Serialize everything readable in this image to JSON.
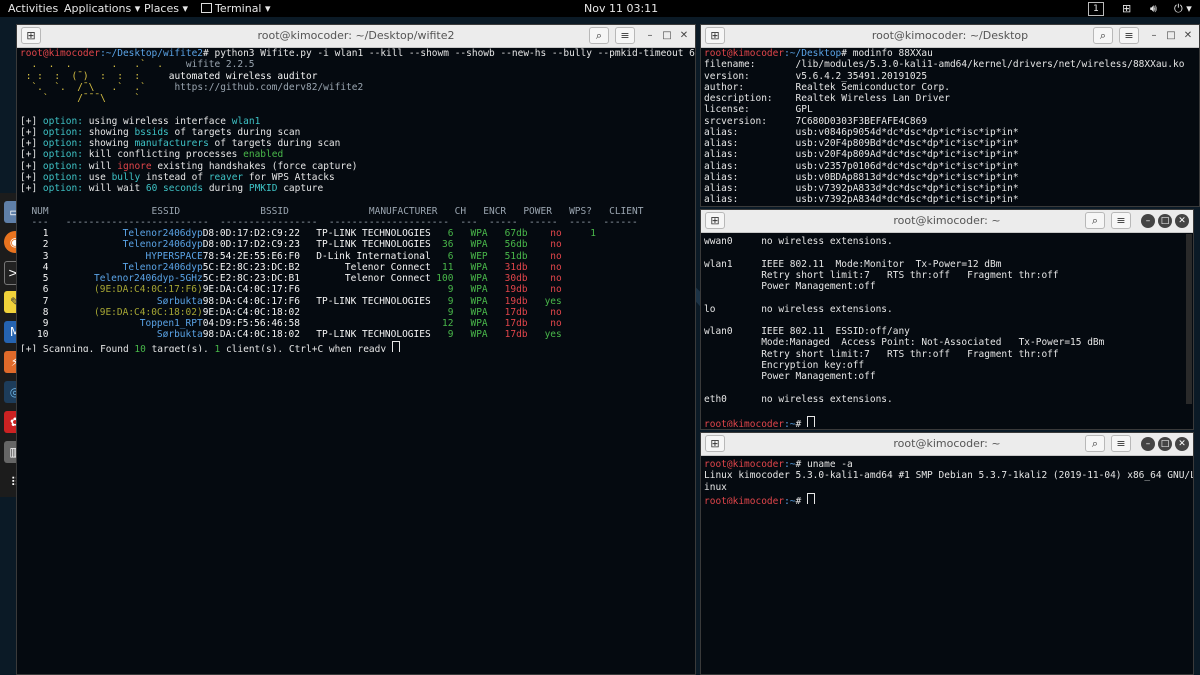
{
  "topbar": {
    "activities": "Activities",
    "applications": "Applications ▾",
    "places": "Places ▾",
    "terminal": "Terminal ▾",
    "clock": "Nov 11  03:11",
    "workspace": "1"
  },
  "dock": {
    "items": [
      "files-icon",
      "firefox-icon",
      "terminal-icon",
      "editor-icon",
      "metasploit-icon",
      "burp-icon",
      "eye-icon",
      "cherrytree-icon",
      "trash-icon",
      "apps-grid-icon"
    ]
  },
  "win1": {
    "title": "root@kimocoder: ~/Desktop/wifite2",
    "prompt_user": "root@kimocoder",
    "prompt_path": ":~/Desktop/wifite2",
    "command": "# python3 Wifite.py -i wlan1 --kill --showm --showb --new-hs --bully --pmkid-timeout 60",
    "logo1": "  .  .  .       .   .`  .",
    "logo2": " : :  :  (¯)  :  :  :",
    "logo3": "  `.  `.  /¯\\   .`  .`",
    "logo4": "    `     /¯¯¯\\     `",
    "app_name": "wifite 2.2.5",
    "app_desc": "automated wireless auditor",
    "app_url": "https://github.com/derv82/wifite2",
    "options": [
      {
        "pre": "using wireless interface ",
        "hl": "wlan1",
        "post": ""
      },
      {
        "pre": "showing ",
        "hl": "bssids",
        "post": " of targets during scan"
      },
      {
        "pre": "showing ",
        "hl": "manufacturers",
        "post": " of targets during scan"
      },
      {
        "pre": "kill conflicting processes ",
        "hl": "enabled",
        "post": ""
      },
      {
        "pre": "will ",
        "hl": "ignore",
        "post": " existing handshakes (force capture)"
      },
      {
        "pre": "use ",
        "hl": "bully",
        "post": " instead of "
      },
      {
        "pre": "will wait ",
        "hl": "60 seconds",
        "post": " during "
      }
    ],
    "opt_bracket": "[+]",
    "opt_label": "option:",
    "opt6_hl2": "reaver",
    "opt6_tail": " for WPS Attacks",
    "opt7_hl2": "PMKID",
    "opt7_tail": " capture",
    "table_header": "  NUM                  ESSID              BSSID              MANUFACTURER   CH   ENCR   POWER   WPS?   CLIENT",
    "table_rule": "  ---   -------------------------  -----------------  ---------------------  ---  -----  -----  ----  ------",
    "rows": [
      {
        "num": "1",
        "essid": "Telenor2406dyp",
        "bssid": "D8:0D:17:D2:C9:22",
        "manu": "TP-LINK TECHNOLOGIES",
        "ch": "6",
        "encr": "WPA",
        "power": "67db",
        "pc": "green",
        "wps": "no",
        "wc": "red",
        "client": "1"
      },
      {
        "num": "2",
        "essid": "Telenor2406dyp",
        "bssid": "D8:0D:17:D2:C9:23",
        "manu": "TP-LINK TECHNOLOGIES",
        "ch": "36",
        "encr": "WPA",
        "power": "56db",
        "pc": "green",
        "wps": "no",
        "wc": "red",
        "client": ""
      },
      {
        "num": "3",
        "essid": "HYPERSPACE",
        "bssid": "78:54:2E:55:E6:F0",
        "manu": "D-Link International",
        "ch": "6",
        "encr": "WEP",
        "power": "51db",
        "pc": "green",
        "wps": "no",
        "wc": "red",
        "client": ""
      },
      {
        "num": "4",
        "essid": "Telenor2406dyp",
        "bssid": "5C:E2:8C:23:DC:B2",
        "manu": "Telenor Connect",
        "ch": "11",
        "encr": "WPA",
        "power": "31db",
        "pc": "red",
        "wps": "no",
        "wc": "red",
        "client": ""
      },
      {
        "num": "5",
        "essid": "Telenor2406dyp-5GHz",
        "bssid": "5C:E2:8C:23:DC:B1",
        "manu": "Telenor Connect",
        "ch": "100",
        "encr": "WPA",
        "power": "30db",
        "pc": "red",
        "wps": "no",
        "wc": "red",
        "client": ""
      },
      {
        "num": "6",
        "essid": "(9E:DA:C4:0C:17:F6)",
        "bssid": "9E:DA:C4:0C:17:F6",
        "manu": "",
        "ch": "9",
        "encr": "WPA",
        "power": "19db",
        "pc": "red",
        "wps": "no",
        "wc": "red",
        "client": ""
      },
      {
        "num": "7",
        "essid": "Sørbukta",
        "bssid": "98:DA:C4:0C:17:F6",
        "manu": "TP-LINK TECHNOLOGIES",
        "ch": "9",
        "encr": "WPA",
        "power": "19db",
        "pc": "red",
        "wps": "yes",
        "wc": "green",
        "client": ""
      },
      {
        "num": "8",
        "essid": "(9E:DA:C4:0C:18:02)",
        "bssid": "9E:DA:C4:0C:18:02",
        "manu": "",
        "ch": "9",
        "encr": "WPA",
        "power": "17db",
        "pc": "red",
        "wps": "no",
        "wc": "red",
        "client": ""
      },
      {
        "num": "9",
        "essid": "Toppen1_RPT",
        "bssid": "04:D9:F5:56:46:58",
        "manu": "",
        "ch": "12",
        "encr": "WPA",
        "power": "17db",
        "pc": "red",
        "wps": "no",
        "wc": "red",
        "client": ""
      },
      {
        "num": "10",
        "essid": "Sørbukta",
        "bssid": "98:DA:C4:0C:18:02",
        "manu": "TP-LINK TECHNOLOGIES",
        "ch": "9",
        "encr": "WPA",
        "power": "17db",
        "pc": "red",
        "wps": "yes",
        "wc": "green",
        "client": ""
      }
    ],
    "scan_pre": "[+] Scanning. Found ",
    "scan_targets": "10",
    "scan_mid": " target(s), ",
    "scan_clients": "1",
    "scan_post": " client(s). Ctrl+C when ready "
  },
  "win2": {
    "title": "root@kimocoder: ~/Desktop",
    "prompt_user": "root@kimocoder",
    "prompt_path": ":~/Desktop",
    "command": "# modinfo 88XXau",
    "lines": [
      "filename:       /lib/modules/5.3.0-kali1-amd64/kernel/drivers/net/wireless/88XXau.ko",
      "version:        v5.6.4.2_35491.20191025",
      "author:         Realtek Semiconductor Corp.",
      "description:    Realtek Wireless Lan Driver",
      "license:        GPL",
      "srcversion:     7C680D0303F3BEFAFE4C869",
      "alias:          usb:v0846p9054d*dc*dsc*dp*ic*isc*ip*in*",
      "alias:          usb:v20F4p809Bd*dc*dsc*dp*ic*isc*ip*in*",
      "alias:          usb:v20F4p809Ad*dc*dsc*dp*ic*isc*ip*in*",
      "alias:          usb:v2357p0106d*dc*dsc*dp*ic*isc*ip*in*",
      "alias:          usb:v0BDAp8813d*dc*dsc*dp*ic*isc*ip*in*",
      "alias:          usb:v7392pA833d*dc*dsc*dp*ic*isc*ip*in*",
      "alias:          usb:v7392pA834d*dc*dsc*dp*ic*isc*ip*in*"
    ]
  },
  "win3": {
    "title": "root@kimocoder: ~",
    "lines": [
      "wwan0     no wireless extensions.",
      "",
      "wlan1     IEEE 802.11  Mode:Monitor  Tx-Power=12 dBm",
      "          Retry short limit:7   RTS thr:off   Fragment thr:off",
      "          Power Management:off",
      "",
      "lo        no wireless extensions.",
      "",
      "wlan0     IEEE 802.11  ESSID:off/any",
      "          Mode:Managed  Access Point: Not-Associated   Tx-Power=15 dBm",
      "          Retry short limit:7   RTS thr:off   Fragment thr:off",
      "          Encryption key:off",
      "          Power Management:off",
      "",
      "eth0      no wireless extensions.",
      ""
    ],
    "prompt_user": "root@kimocoder",
    "prompt_path": ":~",
    "prompt_end": "# "
  },
  "win4": {
    "title": "root@kimocoder: ~",
    "prompt_user": "root@kimocoder",
    "prompt_path": ":~",
    "command": "# uname -a",
    "out1": "Linux kimocoder 5.3.0-kali1-amd64 #1 SMP Debian 5.3.7-1kali2 (2019-11-04) x86_64 GNU/L",
    "out2": "inux",
    "prompt_end": "# "
  },
  "colors": {
    "prompt_red": "#e0454a",
    "path_blue": "#5aa3e6",
    "good_green": "#49b84a",
    "bad_red": "#e0454a"
  }
}
